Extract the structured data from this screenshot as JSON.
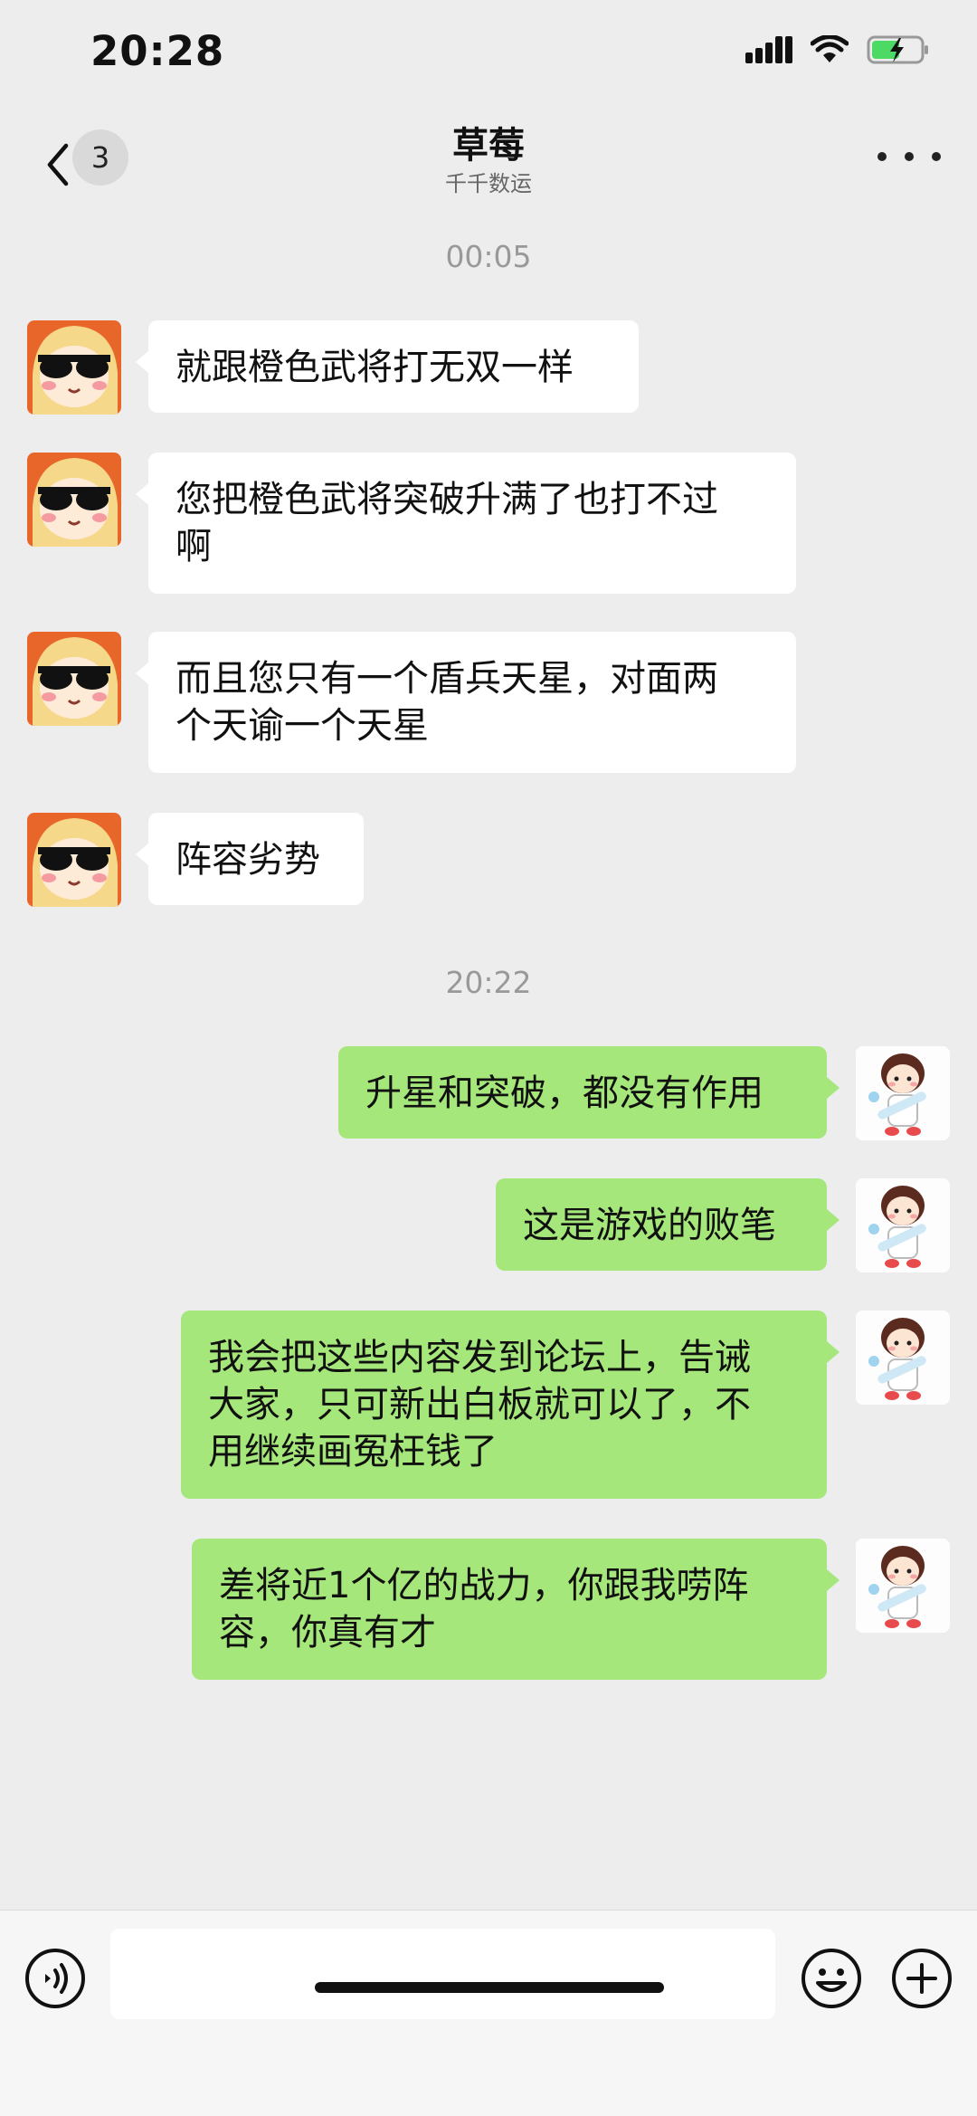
{
  "status_bar": {
    "time": "20:28"
  },
  "header": {
    "back_icon": "chevron-left-icon",
    "unread_count": "3",
    "title": "草莓",
    "subtitle": "千千数运",
    "more_icon": "more-dots-icon"
  },
  "timestamps": [
    "00:05",
    "20:22"
  ],
  "messages": [
    {
      "from": "them",
      "lines": [
        "就跟橙色武将打无双一样"
      ]
    },
    {
      "from": "them",
      "lines": [
        "您把橙色武将突破升满了也打不过",
        "啊"
      ]
    },
    {
      "from": "them",
      "lines": [
        "而且您只有一个盾兵天星，对面两",
        "个天谕一个天星"
      ]
    },
    {
      "from": "them",
      "lines": [
        "阵容劣势"
      ]
    },
    {
      "from": "me",
      "lines": [
        "升星和突破，都没有作用"
      ]
    },
    {
      "from": "me",
      "lines": [
        "这是游戏的败笔"
      ]
    },
    {
      "from": "me",
      "lines": [
        "我会把这些内容发到论坛上，告诫",
        "大家，只可新出白板就可以了，不",
        "用继续画冤枉钱了"
      ]
    },
    {
      "from": "me",
      "lines": [
        "差将近1个亿的战力，你跟我唠阵",
        "容，你真有才"
      ]
    }
  ],
  "input_bar": {
    "voice_icon": "voice-icon",
    "input_value": "",
    "emoji_icon": "emoji-icon",
    "plus_icon": "plus-icon"
  }
}
